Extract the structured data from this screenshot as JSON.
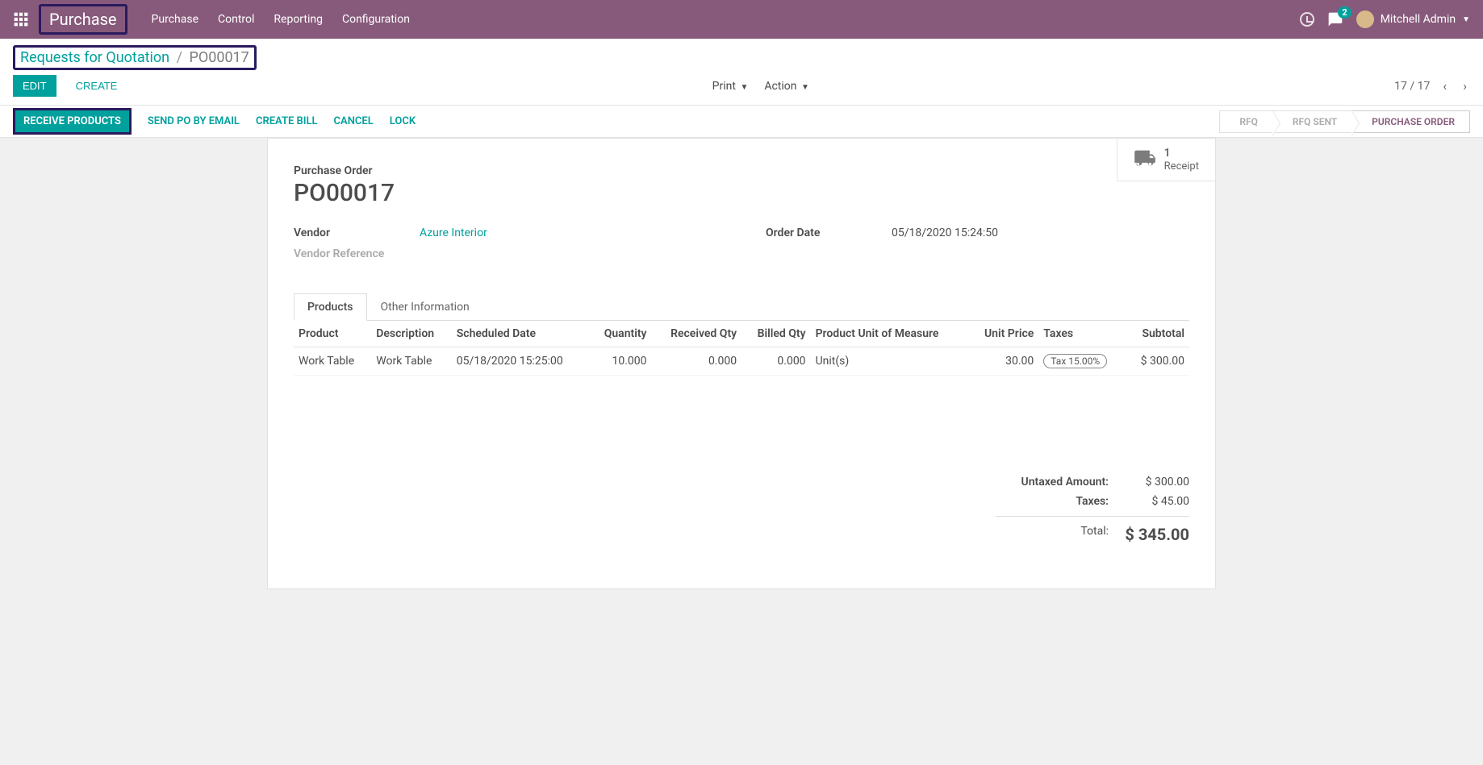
{
  "nav": {
    "brand": "Purchase",
    "menu": [
      "Purchase",
      "Control",
      "Reporting",
      "Configuration"
    ],
    "chat_badge": "2",
    "user_name": "Mitchell Admin"
  },
  "breadcrumb": {
    "parent": "Requests for Quotation",
    "current": "PO00017"
  },
  "control_buttons": {
    "edit": "EDIT",
    "create": "CREATE"
  },
  "center_menus": {
    "print": "Print",
    "action": "Action"
  },
  "pager": {
    "position": "17 / 17"
  },
  "status_actions": {
    "receive": "RECEIVE PRODUCTS",
    "send": "SEND PO BY EMAIL",
    "bill": "CREATE BILL",
    "cancel": "CANCEL",
    "lock": "LOCK"
  },
  "status_steps": {
    "rfq": "RFQ",
    "rfq_sent": "RFQ SENT",
    "po": "PURCHASE ORDER"
  },
  "button_box": {
    "count": "1",
    "label": "Receipt"
  },
  "form": {
    "title_label": "Purchase Order",
    "order_name": "PO00017",
    "labels": {
      "vendor": "Vendor",
      "vendor_ref": "Vendor Reference",
      "order_date": "Order Date"
    },
    "vendor": "Azure Interior",
    "order_date": "05/18/2020 15:24:50"
  },
  "tabs": {
    "products": "Products",
    "other": "Other Information"
  },
  "table": {
    "headers": {
      "product": "Product",
      "description": "Description",
      "scheduled": "Scheduled Date",
      "quantity": "Quantity",
      "received": "Received Qty",
      "billed": "Billed Qty",
      "uom": "Product Unit of Measure",
      "unit_price": "Unit Price",
      "taxes": "Taxes",
      "subtotal": "Subtotal"
    },
    "rows": [
      {
        "product": "Work Table",
        "description": "Work Table",
        "scheduled": "05/18/2020 15:25:00",
        "quantity": "10.000",
        "received": "0.000",
        "billed": "0.000",
        "uom": "Unit(s)",
        "unit_price": "30.00",
        "tax": "Tax 15.00%",
        "subtotal": "$ 300.00"
      }
    ]
  },
  "totals": {
    "untaxed_label": "Untaxed Amount:",
    "untaxed": "$ 300.00",
    "taxes_label": "Taxes:",
    "taxes": "$ 45.00",
    "total_label": "Total:",
    "total": "$ 345.00"
  }
}
